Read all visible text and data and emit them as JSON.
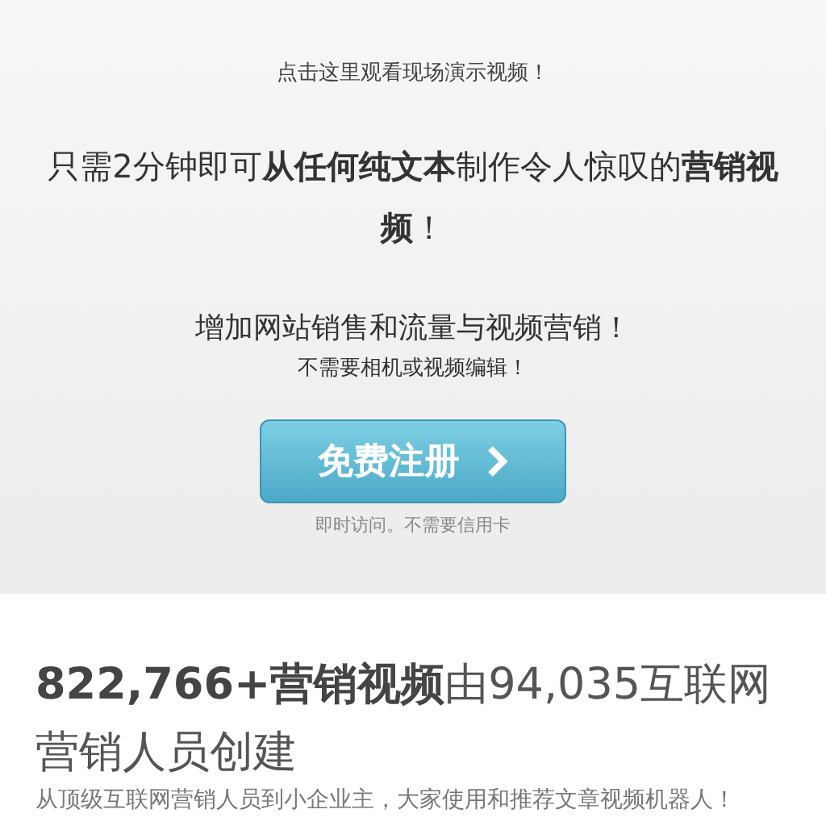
{
  "hero": {
    "demo_link": "点击这里观看现场演示视频！",
    "headline": "只需2分钟即可**从任何纯文本**制作令人惊叹的**营销视频**！",
    "subheadline": "增加网站销售和流量与视频营销！",
    "subnote": "不需要相机或视频编辑！",
    "cta_button": "免费注册",
    "cta_note": "即时访问。不需要信用卡"
  },
  "stats": {
    "heading": "**822,766+营销视频**由94,035互联网营销人员创建",
    "description": "从顶级互联网营销人员到小企业主，大家使用和推荐文章视频机器人！"
  }
}
